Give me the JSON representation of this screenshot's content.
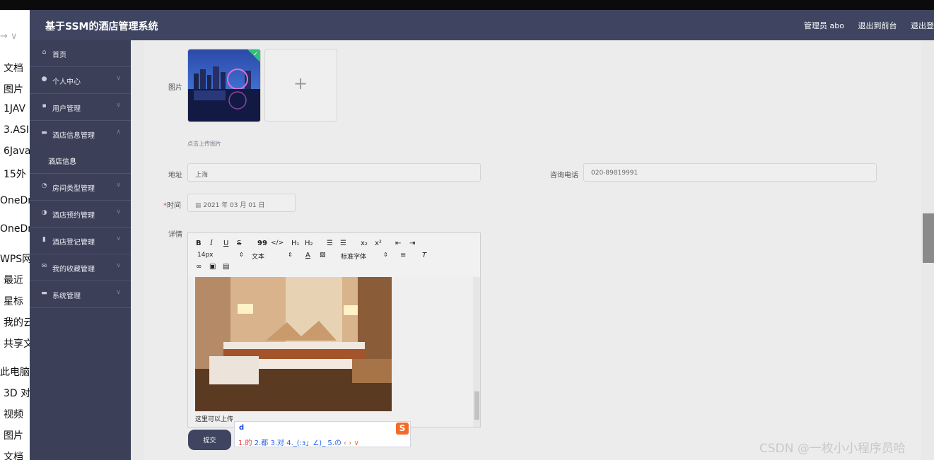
{
  "header": {
    "title": "基于SSM的酒店管理系统",
    "user": "管理员 abo",
    "to_front": "退出到前台",
    "logout": "退出登"
  },
  "sidebar": {
    "items": [
      {
        "label": "首页",
        "icon": "home-icon"
      },
      {
        "label": "个人中心",
        "icon": "user-icon"
      },
      {
        "label": "用户管理",
        "icon": "chat-icon"
      },
      {
        "label": "酒店信息管理",
        "icon": "monitor-icon",
        "expanded": true
      },
      {
        "label": "酒店信息",
        "sub": true
      },
      {
        "label": "房间类型管理",
        "icon": "clock-icon"
      },
      {
        "label": "酒店预约管理",
        "icon": "gauge-icon"
      },
      {
        "label": "酒店登记管理",
        "icon": "bar-chart-icon"
      },
      {
        "label": "我的收藏管理",
        "icon": "mail-icon"
      },
      {
        "label": "系统管理",
        "icon": "server-icon"
      }
    ]
  },
  "explorer": {
    "nav": "→ ∨",
    "items": [
      "文档",
      "图片",
      "1JAV",
      "3.ASI",
      "6Java",
      "15外",
      "OneDr",
      "OneDr",
      "WPS网",
      "最近",
      "星标",
      "我的云",
      "共享文",
      "此电脑",
      "3D 对",
      "视频",
      "图片",
      "文档"
    ]
  },
  "form": {
    "image_label": "图片",
    "upload_tip": "点击上传图片",
    "address_label": "地址",
    "address_value": "上海",
    "phone_label": "咨询电话",
    "phone_value": "020-89819991",
    "time_required": "*",
    "time_label": "时间",
    "time_value": "2021 年 03 月 01 日",
    "detail_label": "详情",
    "submit": "提交"
  },
  "editor": {
    "font_size": "14px",
    "paragraph": "文本",
    "font_family": "标准字体",
    "caption": "这里可以上传"
  },
  "ime": {
    "typed": "d",
    "candidates": [
      "1.的",
      "2.都",
      "3.对",
      "4._(:з」∠)_",
      "5.の"
    ],
    "nav": "‹ › ∨"
  },
  "watermark": "CSDN @一枚小小程序员哈"
}
